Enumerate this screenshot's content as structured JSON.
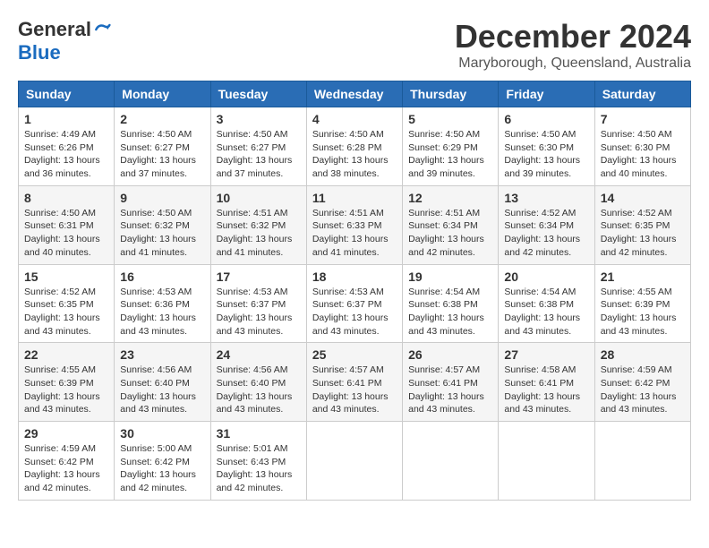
{
  "logo": {
    "general": "General",
    "blue": "Blue"
  },
  "title": {
    "month": "December 2024",
    "location": "Maryborough, Queensland, Australia"
  },
  "headers": [
    "Sunday",
    "Monday",
    "Tuesday",
    "Wednesday",
    "Thursday",
    "Friday",
    "Saturday"
  ],
  "weeks": [
    [
      {
        "day": 1,
        "sunrise": "4:49 AM",
        "sunset": "6:26 PM",
        "daylight": "13 hours and 36 minutes."
      },
      {
        "day": 2,
        "sunrise": "4:50 AM",
        "sunset": "6:27 PM",
        "daylight": "13 hours and 37 minutes."
      },
      {
        "day": 3,
        "sunrise": "4:50 AM",
        "sunset": "6:27 PM",
        "daylight": "13 hours and 37 minutes."
      },
      {
        "day": 4,
        "sunrise": "4:50 AM",
        "sunset": "6:28 PM",
        "daylight": "13 hours and 38 minutes."
      },
      {
        "day": 5,
        "sunrise": "4:50 AM",
        "sunset": "6:29 PM",
        "daylight": "13 hours and 39 minutes."
      },
      {
        "day": 6,
        "sunrise": "4:50 AM",
        "sunset": "6:30 PM",
        "daylight": "13 hours and 39 minutes."
      },
      {
        "day": 7,
        "sunrise": "4:50 AM",
        "sunset": "6:30 PM",
        "daylight": "13 hours and 40 minutes."
      }
    ],
    [
      {
        "day": 8,
        "sunrise": "4:50 AM",
        "sunset": "6:31 PM",
        "daylight": "13 hours and 40 minutes."
      },
      {
        "day": 9,
        "sunrise": "4:50 AM",
        "sunset": "6:32 PM",
        "daylight": "13 hours and 41 minutes."
      },
      {
        "day": 10,
        "sunrise": "4:51 AM",
        "sunset": "6:32 PM",
        "daylight": "13 hours and 41 minutes."
      },
      {
        "day": 11,
        "sunrise": "4:51 AM",
        "sunset": "6:33 PM",
        "daylight": "13 hours and 41 minutes."
      },
      {
        "day": 12,
        "sunrise": "4:51 AM",
        "sunset": "6:34 PM",
        "daylight": "13 hours and 42 minutes."
      },
      {
        "day": 13,
        "sunrise": "4:52 AM",
        "sunset": "6:34 PM",
        "daylight": "13 hours and 42 minutes."
      },
      {
        "day": 14,
        "sunrise": "4:52 AM",
        "sunset": "6:35 PM",
        "daylight": "13 hours and 42 minutes."
      }
    ],
    [
      {
        "day": 15,
        "sunrise": "4:52 AM",
        "sunset": "6:35 PM",
        "daylight": "13 hours and 43 minutes."
      },
      {
        "day": 16,
        "sunrise": "4:53 AM",
        "sunset": "6:36 PM",
        "daylight": "13 hours and 43 minutes."
      },
      {
        "day": 17,
        "sunrise": "4:53 AM",
        "sunset": "6:37 PM",
        "daylight": "13 hours and 43 minutes."
      },
      {
        "day": 18,
        "sunrise": "4:53 AM",
        "sunset": "6:37 PM",
        "daylight": "13 hours and 43 minutes."
      },
      {
        "day": 19,
        "sunrise": "4:54 AM",
        "sunset": "6:38 PM",
        "daylight": "13 hours and 43 minutes."
      },
      {
        "day": 20,
        "sunrise": "4:54 AM",
        "sunset": "6:38 PM",
        "daylight": "13 hours and 43 minutes."
      },
      {
        "day": 21,
        "sunrise": "4:55 AM",
        "sunset": "6:39 PM",
        "daylight": "13 hours and 43 minutes."
      }
    ],
    [
      {
        "day": 22,
        "sunrise": "4:55 AM",
        "sunset": "6:39 PM",
        "daylight": "13 hours and 43 minutes."
      },
      {
        "day": 23,
        "sunrise": "4:56 AM",
        "sunset": "6:40 PM",
        "daylight": "13 hours and 43 minutes."
      },
      {
        "day": 24,
        "sunrise": "4:56 AM",
        "sunset": "6:40 PM",
        "daylight": "13 hours and 43 minutes."
      },
      {
        "day": 25,
        "sunrise": "4:57 AM",
        "sunset": "6:41 PM",
        "daylight": "13 hours and 43 minutes."
      },
      {
        "day": 26,
        "sunrise": "4:57 AM",
        "sunset": "6:41 PM",
        "daylight": "13 hours and 43 minutes."
      },
      {
        "day": 27,
        "sunrise": "4:58 AM",
        "sunset": "6:41 PM",
        "daylight": "13 hours and 43 minutes."
      },
      {
        "day": 28,
        "sunrise": "4:59 AM",
        "sunset": "6:42 PM",
        "daylight": "13 hours and 43 minutes."
      }
    ],
    [
      {
        "day": 29,
        "sunrise": "4:59 AM",
        "sunset": "6:42 PM",
        "daylight": "13 hours and 42 minutes."
      },
      {
        "day": 30,
        "sunrise": "5:00 AM",
        "sunset": "6:42 PM",
        "daylight": "13 hours and 42 minutes."
      },
      {
        "day": 31,
        "sunrise": "5:01 AM",
        "sunset": "6:43 PM",
        "daylight": "13 hours and 42 minutes."
      },
      null,
      null,
      null,
      null
    ]
  ]
}
